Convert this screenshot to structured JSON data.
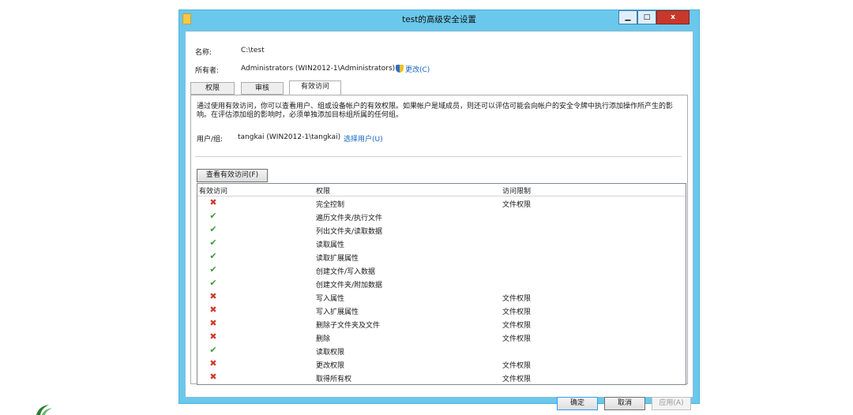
{
  "window": {
    "title": "test的高级安全设置"
  },
  "header": {
    "name_label": "名称:",
    "name_value": "C:\\test",
    "owner_label": "所有者:",
    "owner_value": "Administrators (WIN2012-1\\Administrators)",
    "change_link": "更改(C)"
  },
  "tabs": [
    {
      "label": "权限"
    },
    {
      "label": "审核"
    },
    {
      "label": "有效访问"
    }
  ],
  "panel": {
    "description": "通过使用有效访问，你可以查看用户、组或设备帐户的有效权限。如果帐户是域成员，则还可以评估可能会向帐户的安全令牌中执行添加操作所产生的影响。在评估添加组的影响时，必须单独添加目标组所属的任何组。",
    "user_group_label": "用户/组:",
    "user_group_value": "tangkai (WIN2012-1\\tangkai)",
    "select_user_link": "选择用户(U)",
    "view_button": "查看有效访问(F)"
  },
  "list": {
    "columns": [
      "有效访问",
      "权限",
      "访问限制"
    ],
    "rows": [
      {
        "access": "deny",
        "permission": "完全控制",
        "limit": "文件权限"
      },
      {
        "access": "allow",
        "permission": "遍历文件夹/执行文件",
        "limit": ""
      },
      {
        "access": "allow",
        "permission": "列出文件夹/读取数据",
        "limit": ""
      },
      {
        "access": "allow",
        "permission": "读取属性",
        "limit": ""
      },
      {
        "access": "allow",
        "permission": "读取扩展属性",
        "limit": ""
      },
      {
        "access": "allow",
        "permission": "创建文件/写入数据",
        "limit": ""
      },
      {
        "access": "allow",
        "permission": "创建文件夹/附加数据",
        "limit": ""
      },
      {
        "access": "deny",
        "permission": "写入属性",
        "limit": "文件权限"
      },
      {
        "access": "deny",
        "permission": "写入扩展属性",
        "limit": "文件权限"
      },
      {
        "access": "deny",
        "permission": "删除子文件夹及文件",
        "limit": "文件权限"
      },
      {
        "access": "deny",
        "permission": "删除",
        "limit": "文件权限"
      },
      {
        "access": "allow",
        "permission": "读取权限",
        "limit": ""
      },
      {
        "access": "deny",
        "permission": "更改权限",
        "limit": "文件权限"
      },
      {
        "access": "deny",
        "permission": "取得所有权",
        "limit": "文件权限"
      }
    ]
  },
  "footer": {
    "ok": "确定",
    "cancel": "取消",
    "apply": "应用(A)"
  },
  "icons": {
    "deny": "red-x-icon",
    "allow": "green-check-user-icon",
    "owner_change": "uac-shield-icon",
    "window": "folder-icon"
  },
  "colors": {
    "titlebar": "#6ac8ec",
    "close_button": "#c7382b",
    "link": "#1565c0",
    "deny": "#d23a2a",
    "allow": "#3a9a3a"
  }
}
